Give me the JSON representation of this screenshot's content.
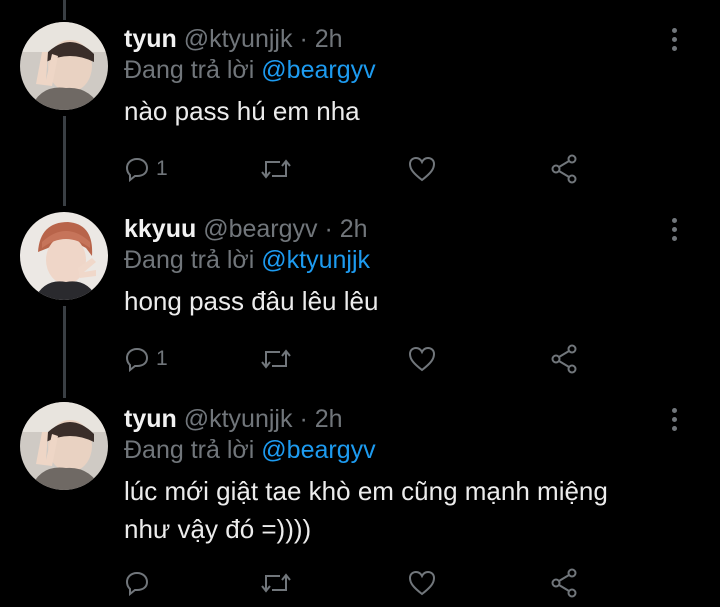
{
  "tweets": [
    {
      "name": "tyun",
      "handle": "@ktyunjjk",
      "dot": "·",
      "time": "2h",
      "reply_prefix": "Đang trả lời",
      "reply_to": "@beargyv",
      "text": "nào pass hú em nha",
      "reply_count": "1"
    },
    {
      "name": "kkyuu",
      "handle": "@beargyv",
      "dot": "·",
      "time": "2h",
      "reply_prefix": "Đang trả lời",
      "reply_to": "@ktyunjjk",
      "text": "hong pass đâu lêu lêu",
      "reply_count": "1"
    },
    {
      "name": "tyun",
      "handle": "@ktyunjjk",
      "dot": "·",
      "time": "2h",
      "reply_prefix": "Đang trả lời",
      "reply_to": "@beargyv",
      "text": "lúc mới giật tae khò em cũng mạnh miệng như vậy đó =))))",
      "reply_count": ""
    }
  ],
  "icons": {
    "reply": "comment-icon",
    "retweet": "retweet-icon",
    "like": "heart-icon",
    "share": "share-icon",
    "more": "more-vertical-icon"
  },
  "colors": {
    "background": "#000000",
    "mention": "#1d9bf0",
    "muted": "#71767b"
  }
}
